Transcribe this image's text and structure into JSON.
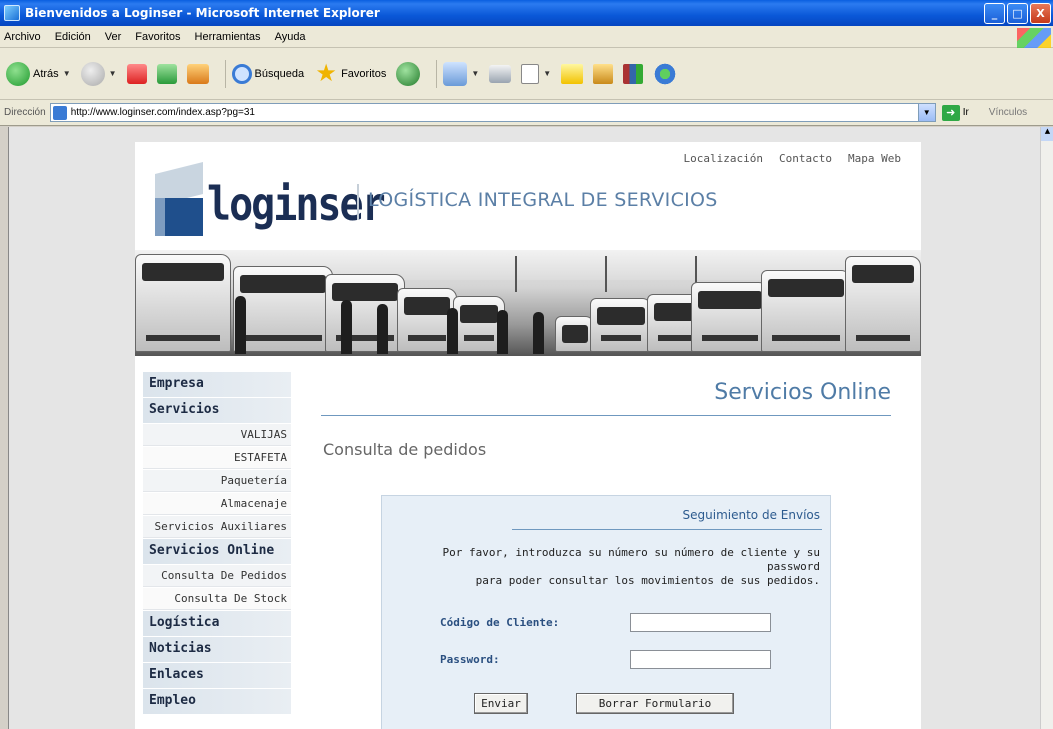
{
  "window": {
    "title": "Bienvenidos a Loginser - Microsoft Internet Explorer",
    "controls": [
      "_",
      "□",
      "X"
    ]
  },
  "menu": [
    "Archivo",
    "Edición",
    "Ver",
    "Favoritos",
    "Herramientas",
    "Ayuda"
  ],
  "toolbar": {
    "back_label": "Atrás",
    "search_label": "Búsqueda",
    "favorites_label": "Favoritos"
  },
  "address": {
    "label": "Dirección",
    "url": "http://www.loginser.com/index.asp?pg=31",
    "go_label": "Ir",
    "links_label": "Vínculos"
  },
  "site": {
    "logo_text": "loginser",
    "tagline": "LOGÍSTICA INTEGRAL DE SERVICIOS",
    "top_links": [
      "Localización",
      "Contacto",
      "Mapa Web"
    ]
  },
  "sidebar": {
    "items": [
      {
        "label": "Empresa",
        "type": "main"
      },
      {
        "label": "Servicios",
        "type": "main"
      },
      {
        "label": "VALIJAS",
        "type": "sub"
      },
      {
        "label": "ESTAFETA",
        "type": "sub"
      },
      {
        "label": "Paquetería",
        "type": "sub"
      },
      {
        "label": "Almacenaje",
        "type": "sub"
      },
      {
        "label": "Servicios Auxiliares",
        "type": "sub"
      },
      {
        "label": "Servicios Online",
        "type": "main"
      },
      {
        "label": "Consulta De Pedidos",
        "type": "sub"
      },
      {
        "label": "Consulta De Stock",
        "type": "sub"
      },
      {
        "label": "Logística",
        "type": "main"
      },
      {
        "label": "Noticias",
        "type": "main"
      },
      {
        "label": "Enlaces",
        "type": "main"
      },
      {
        "label": "Empleo",
        "type": "main"
      }
    ]
  },
  "main": {
    "heading": "Servicios Online",
    "subheading": "Consulta de pedidos",
    "form": {
      "title": "Seguimiento de Envíos",
      "intro_line1": "Por favor, introduzca su número su número de cliente y su password",
      "intro_line2": "para poder consultar los movimientos de sus pedidos.",
      "client_label": "Código de Cliente:",
      "client_value": "",
      "password_label": "Password:",
      "password_value": "",
      "submit_label": "Enviar",
      "reset_label": "Borrar Formulario"
    }
  },
  "colors": {
    "accent": "#4f7ba6",
    "nav_text": "#1d2b44",
    "form_label": "#2a4f80",
    "titlebar": "#0a58d8"
  }
}
